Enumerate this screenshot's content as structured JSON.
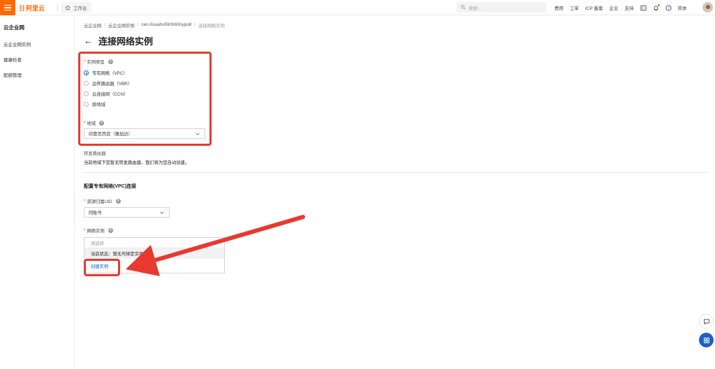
{
  "topbar": {
    "logo_text": "阿里云",
    "logo_mark": "[-]",
    "workbench_label": "工作台",
    "search_placeholder": "搜索...",
    "nav": [
      "费用",
      "工单",
      "ICP 备案",
      "企业",
      "支持"
    ],
    "lang_label": "简体"
  },
  "sidebar": {
    "title": "云企业网",
    "items": [
      "云企业网实例",
      "健康检查",
      "配额管理"
    ]
  },
  "breadcrumb": [
    "云企业网",
    "云企业网实例",
    "cen-0ouahv59r0r60nypo8",
    "连接网络实例"
  ],
  "page_title": "连接网络实例",
  "form": {
    "instance_type_label": "实例类型",
    "instance_types": [
      "专有网络（VPC）",
      "边界路由器（VBR）",
      "云连接网（CCN）",
      "跨地域"
    ],
    "selected_instance_type": "专有网络（VPC）",
    "region_label": "地域",
    "region_value": "印度尼西亚（雅加达）",
    "transit_router_label": "转发路由器",
    "transit_router_info": "当前地域下您暂无转发路由器，我们将为您自动创建。",
    "section_title": "配置专有网络(VPC)连接",
    "account_uid_label": "资源归属UID",
    "account_value": "同账号",
    "network_instance_label": "网络实例",
    "network_instance_placeholder": "请选择",
    "dropdown_status": "当前状态：暂无可绑定实例",
    "create_instance_link": "创建实例"
  },
  "colors": {
    "brand_orange": "#ff6a00",
    "link_blue": "#0064c8",
    "highlight_red": "#e8392f"
  }
}
